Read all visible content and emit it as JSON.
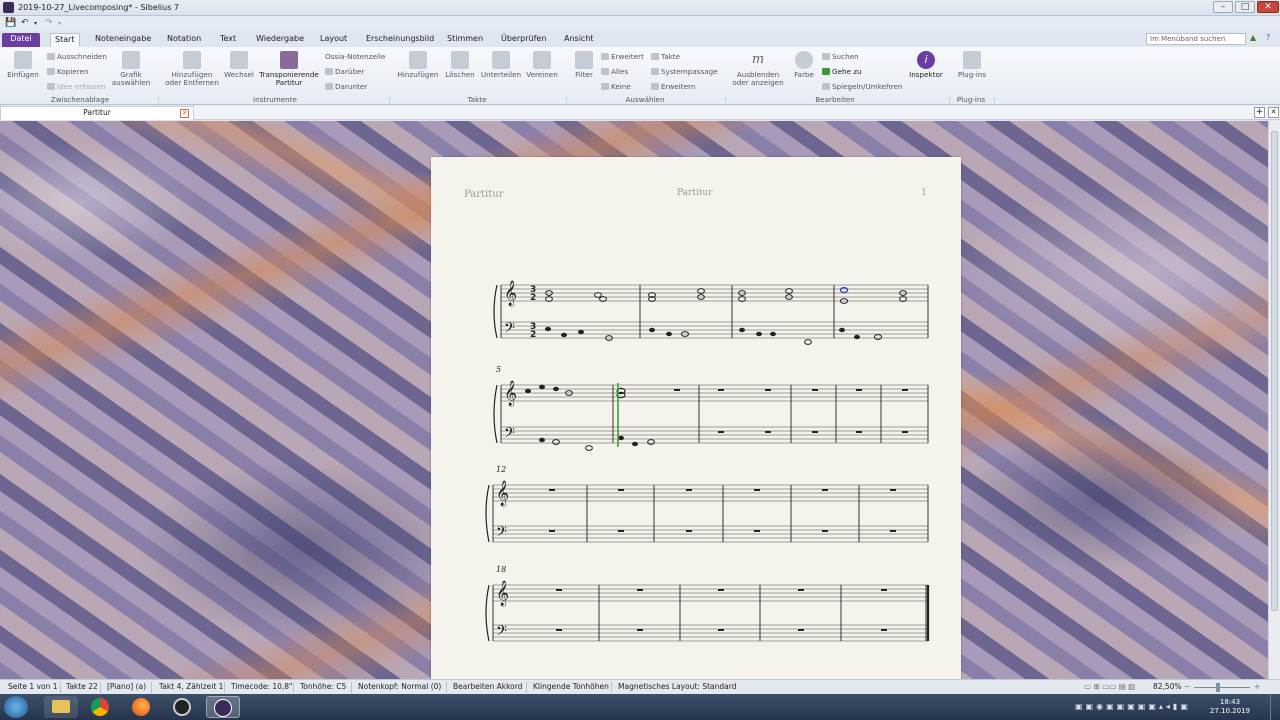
{
  "window": {
    "title": "2019-10-27_Livecomposing* - Sibelius 7"
  },
  "ribbon_tabs": [
    {
      "label": "Datei"
    },
    {
      "label": "Start"
    },
    {
      "label": "Noteneingabe"
    },
    {
      "label": "Notation"
    },
    {
      "label": "Text"
    },
    {
      "label": "Wiedergabe"
    },
    {
      "label": "Layout"
    },
    {
      "label": "Erscheinungsbild"
    },
    {
      "label": "Stimmen"
    },
    {
      "label": "Überprüfen"
    },
    {
      "label": "Ansicht"
    }
  ],
  "search": {
    "placeholder": "Im Menüband suchen"
  },
  "ribbon": {
    "clipboard": {
      "paste": "Einfügen",
      "cut": "Ausschneiden",
      "copy": "Kopieren",
      "capture": "Idee erfassen",
      "graphic": "Grafik auswählen",
      "group": "Zwischenablage"
    },
    "instruments": {
      "add": "Hinzufügen oder Entfernen",
      "change": "Wechsel",
      "transpose": "Transponierende Partitur",
      "ossia": "Ossia-Notenzeile",
      "above": "Darüber",
      "below": "Darunter",
      "group": "Instrumente"
    },
    "bars": {
      "add": "Hinzufügen",
      "delete": "Löschen",
      "split": "Unterteilen",
      "join": "Vereinen",
      "group": "Takte"
    },
    "selection": {
      "filter": "Filter",
      "advanced": "Erweitert",
      "all": "Alles",
      "none": "Keine",
      "bars": "Takte",
      "passage": "Systempassage",
      "extend": "Erweitern",
      "group": "Auswählen"
    },
    "edit": {
      "hide": "Ausblenden oder anzeigen",
      "color": "Farbe",
      "find": "Suchen",
      "goto": "Gehe zu",
      "flip": "Spiegeln/Umkehren",
      "group": "Bearbeiten"
    },
    "inspector": {
      "label": "Inspektor"
    },
    "plugins": {
      "label": "Plug-ins",
      "group": "Plug-ins"
    }
  },
  "doc_tab": {
    "label": "Partitur"
  },
  "score": {
    "header_left": "Partitur",
    "header_center": "Partitur",
    "page_number": "1",
    "system_numbers": [
      "5",
      "12",
      "18"
    ]
  },
  "status": {
    "page": "Seite 1 von 1",
    "bars": "Takte 22",
    "instrument": "[Piano] (a)",
    "position": "Takt 4, Zählzeit 1",
    "timecode": "Timecode: 10,8\"",
    "pitch": "Tonhöhe: C5",
    "notehead": "Notenkopf: Normal (0)",
    "edit": "Bearbeiten Akkord",
    "sounding": "Klingende Tonhöhen",
    "layout": "Magnetisches Layout: Standard",
    "zoom": "82,50%"
  },
  "taskbar": {
    "time": "18:43",
    "date": "27.10.2019"
  },
  "colors": {
    "file_tab": "#6a3ea0",
    "selection_green": "#2ea82e",
    "selected_note_blue": "#2233cc"
  }
}
